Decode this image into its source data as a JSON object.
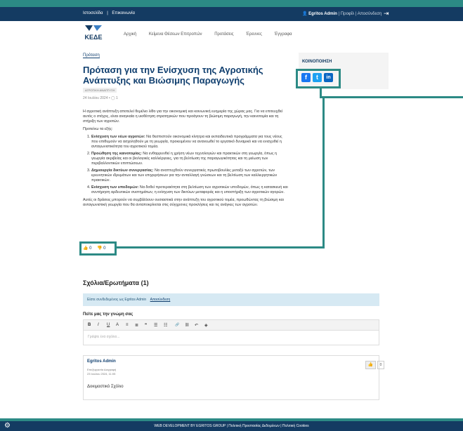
{
  "topbar": {
    "home": "Ιστοσελίδα",
    "contact": "Επικοινωνία",
    "user_name": "Egritos Admin",
    "profile": "Προφίλ",
    "logout": "Αποσύνδεση"
  },
  "header": {
    "logo_text": "ΚΕΔΕ",
    "nav": [
      "Αρχική",
      "Κείμενα Θέσεων Επιτροπών",
      "Προτάσεις",
      "Έρευνες",
      "Έγγραφα"
    ]
  },
  "article": {
    "category": "Πρόταση",
    "title": "Πρόταση για την Ενίσχυση της Αγροτικής Ανάπτυξης και Βιώσιμης Παραγωγής",
    "tag": "ΑΓΡΟΤΙΚΗ ΑΝΑΠΤΥΞΗ",
    "date": "24 Ιουλίου 2024",
    "comment_count": "1",
    "intro": "Η αγροτική ανάπτυξη αποτελεί θεμέλιο λίθο για την οικονομική και κοινωνική ευημερία της χώρας μας. Για να επιτευχθεί αυτός ο στόχος, είναι αναγκαία η υιοθέτηση στρατηγικών που προάγουν τη βιώσιμη παραγωγή, την καινοτομία και τη στήριξη των αγροτών.",
    "proposals_heading": "Προτείνω τα εξής:",
    "items": [
      {
        "bold": "Ενίσχυση των νέων αγροτών:",
        "text": " Να θεσπιστούν οικονομικά κίνητρα και εκπαιδευτικά προγράμματα για τους νέους που επιθυμούν να ασχοληθούν με τη γεωργία, προκειμένου να ανανεωθεί το εργατικό δυναμικό και να ενισχυθεί η ανταγωνιστικότητα του αγροτικού τομέα."
      },
      {
        "bold": "Προώθηση της καινοτομίας:",
        "text": " Να ενθαρρυνθεί η χρήση νέων τεχνολογιών και πρακτικών στη γεωργία, όπως η γεωργία ακριβείας και οι βιολογικές καλλιέργειες, για τη βελτίωση της παραγωγικότητας και τη μείωση των περιβαλλοντικών επιπτώσεων."
      },
      {
        "bold": "Δημιουργία δικτύων συνεργασίας:",
        "text": " Να αναπτυχθούν συνεργατικές πρωτοβουλίες μεταξύ των αγροτών, των ερευνητικών ιδρυμάτων και των επιχειρήσεων για την ανταλλαγή γνώσεων και τη βελτίωση των καλλιεργητικών πρακτικών."
      },
      {
        "bold": "Ενίσχυση των υποδομών:",
        "text": " Να δοθεί προτεραιότητα στη βελτίωση των αγροτικών υποδομών, όπως η κατασκευή και συντήρηση αρδευτικών συστημάτων, η ενίσχυση των δικτύων μεταφοράς και η υποστήριξη των αγροτικών αγορών."
      }
    ],
    "closing": "Αυτές οι δράσεις μπορούν να συμβάλλουν ουσιαστικά στην ανάπτυξη του αγροτικού τομέα, προωθώντας τη βιώσιμη και ανταγωνιστική γεωργία που θα ανταποκρίνεται στις σύγχρονες προκλήσεις και τις ανάγκες των αγροτών.",
    "likes": "0",
    "dislikes": "0"
  },
  "share": {
    "title": "ΚΟΙΝΟΠΟΙΗΣΗ",
    "facebook_icon": "f",
    "twitter_icon": "t",
    "linkedin_icon": "in",
    "facebook_color": "#1877f2",
    "twitter_color": "#1da1f2",
    "linkedin_color": "#0a66c2"
  },
  "comments": {
    "title": "Σχόλια/Ερωτήματα (1)",
    "logged_in": "Είστε συνδεδεμένος ως Egritos Admin",
    "logout": "Αποσύνδεση",
    "prompt": "Πείτε μας την γνώμη σας",
    "toolbar": [
      "B",
      "I",
      "U",
      "A",
      "≡",
      "≣",
      "❞",
      "☰",
      "☷",
      "🔗",
      "⛓",
      "↶",
      "◈"
    ],
    "placeholder": "Γράψτε ένα σχόλιο...",
    "list": [
      {
        "author": "Egritos Admin",
        "line1": "Επεξεργασία   Διαγραφή",
        "line2": "23 Ιουλίου 2024, 11:05",
        "text": "Δοκιμαστικό Σχόλιο",
        "likes": "0"
      }
    ]
  },
  "footer": {
    "text": "WEB DEVELOPMENT BY EGRITOS GROUP  |  Πολιτική Προστασίας Δεδομένων  |  Πολιτική Cookies"
  }
}
